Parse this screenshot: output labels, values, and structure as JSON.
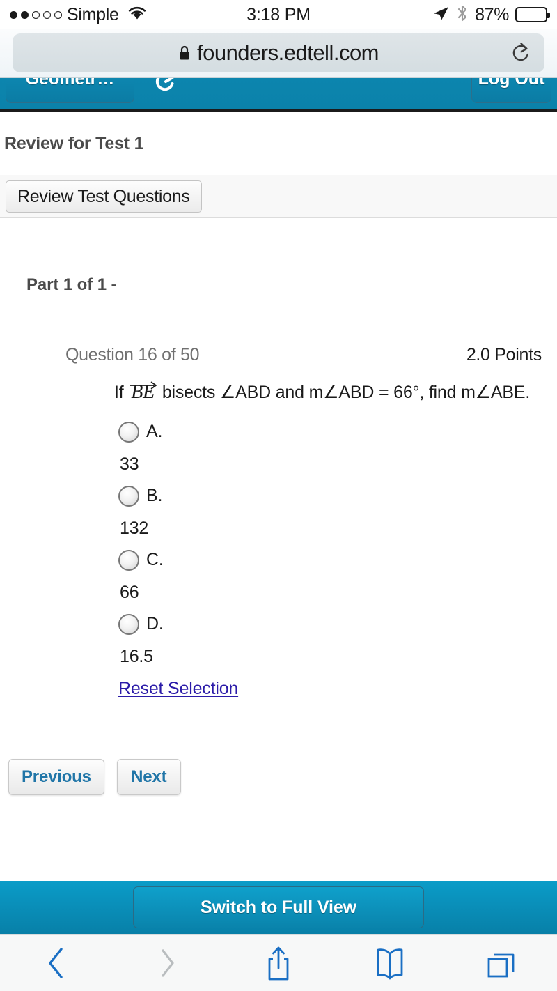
{
  "status_bar": {
    "signal_dots_filled": 2,
    "signal_dots_total": 5,
    "carrier": "Simple",
    "wifi_icon": "wifi-icon",
    "time": "3:18 PM",
    "location_icon": "location-arrow-icon",
    "bluetooth_icon": "bluetooth-icon",
    "battery_percent": "87%",
    "battery_level": 87
  },
  "browser": {
    "lock_icon": "lock-icon",
    "url": "founders.edtell.com",
    "reload_icon": "reload-icon"
  },
  "app_nav": {
    "course_button": "Geometr…",
    "refresh_icon": "refresh-icon",
    "logout_button": "Log Out",
    "accent_color": "#0c85ae"
  },
  "page": {
    "title": "Review for Test 1",
    "tab_label": "Review Test Questions",
    "part_label": "Part 1 of 1 -"
  },
  "question": {
    "counter": "Question 16 of 50",
    "points": "2.0 Points",
    "prefix": "If",
    "ray_label": "BE",
    "ray_icon": "ray-arrow-icon",
    "body": "bisects ∠ABD and m∠ABD = 66°, find m∠ABE.",
    "choices": [
      {
        "letter": "A.",
        "value": "33",
        "selected": false
      },
      {
        "letter": "B.",
        "value": "132",
        "selected": false
      },
      {
        "letter": "C.",
        "value": "66",
        "selected": false
      },
      {
        "letter": "D.",
        "value": "16.5",
        "selected": false
      }
    ],
    "reset_link": "Reset Selection"
  },
  "navigation": {
    "previous": "Previous",
    "next": "Next"
  },
  "footer": {
    "full_view_button": "Switch to Full View",
    "bar_color": "#0a8cb5"
  },
  "toolbar": {
    "back_icon": "back-chevron-icon",
    "forward_icon": "forward-chevron-icon",
    "share_icon": "share-icon",
    "bookmarks_icon": "bookmarks-book-icon",
    "tabs_icon": "tabs-icon",
    "back_enabled": true,
    "forward_enabled": false,
    "active_color": "#1a6fc4",
    "disabled_color": "#b9bdbf"
  }
}
